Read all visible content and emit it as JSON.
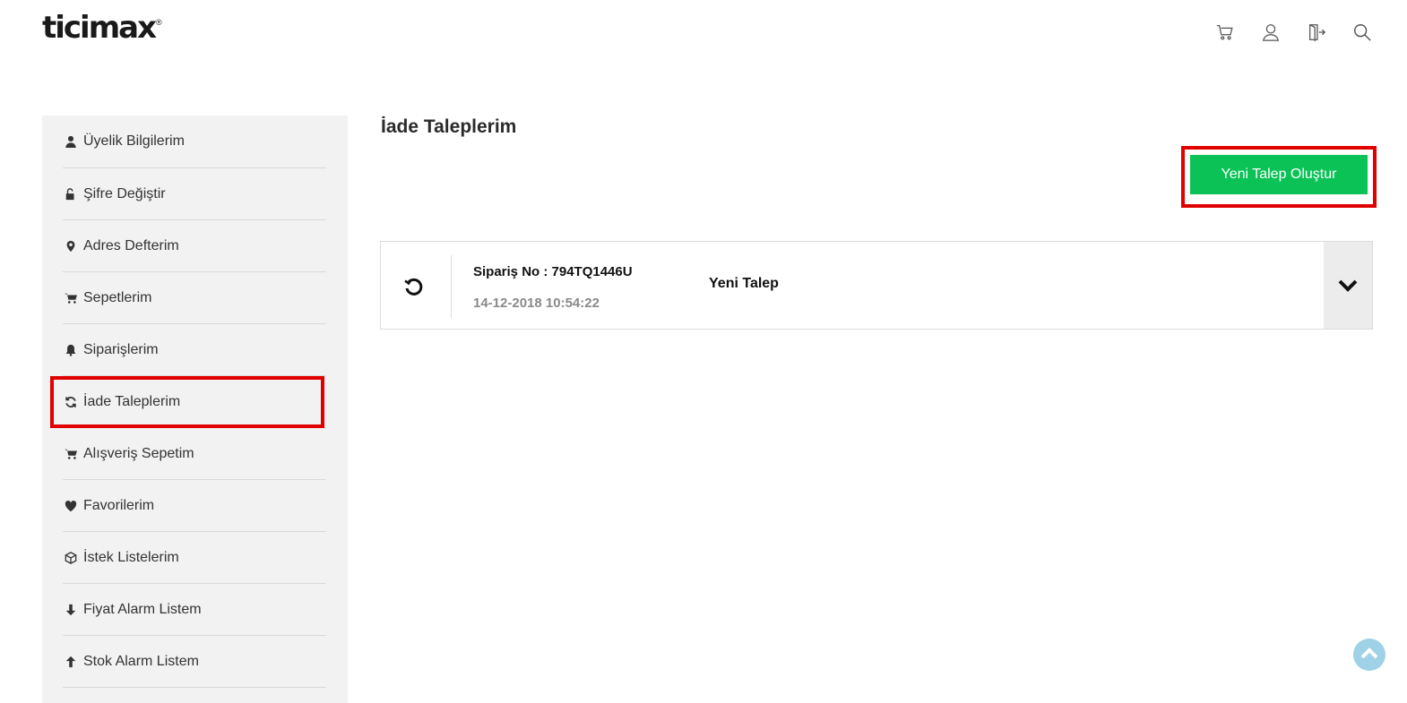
{
  "brand": {
    "logo_text": "ticimax",
    "registered_mark": "®"
  },
  "header": {
    "icons": [
      "cart-icon",
      "user-icon",
      "logout-icon",
      "search-icon"
    ]
  },
  "sidebar": {
    "items": [
      {
        "label": "Üyelik Bilgilerim",
        "icon": "user-icon"
      },
      {
        "label": "Şifre Değiştir",
        "icon": "unlock-icon"
      },
      {
        "label": "Adres Defterim",
        "icon": "map-marker-icon"
      },
      {
        "label": "Sepetlerim",
        "icon": "cart-icon"
      },
      {
        "label": "Siparişlerim",
        "icon": "bell-icon"
      },
      {
        "label": "İade Taleplerim",
        "icon": "refresh-icon",
        "active": true
      },
      {
        "label": "Alışveriş Sepetim",
        "icon": "cart-icon"
      },
      {
        "label": "Favorilerim",
        "icon": "heart-icon"
      },
      {
        "label": "İstek Listelerim",
        "icon": "box-icon"
      },
      {
        "label": "Fiyat Alarm Listem",
        "icon": "arrow-down-icon"
      },
      {
        "label": "Stok Alarm Listem",
        "icon": "arrow-up-icon"
      }
    ]
  },
  "main": {
    "title": "İade Taleplerim",
    "new_request_label": "Yeni Talep Oluştur",
    "requests": [
      {
        "order_no": "Sipariş No : 794TQ1446U",
        "date": "14-12-2018 10:54:22",
        "status": "Yeni Talep"
      }
    ]
  },
  "colors": {
    "accent_green": "#0ac256",
    "highlight_red": "#e10000",
    "sidebar_bg": "#f2f2f2",
    "scroll_top_bg": "#9fd2e6"
  }
}
